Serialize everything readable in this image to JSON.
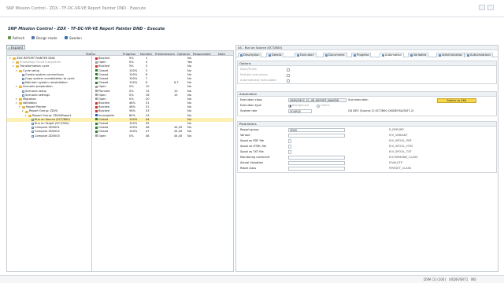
{
  "window": {
    "app_title": "SNP Mission Control - ZDX - TF-DC-VR-VE Report Painter DND - Execute"
  },
  "page": {
    "title": "SNP Mission Control - ZDX - TF-DC-VR-VE Report Painter DND - Execute"
  },
  "toolbar": {
    "refresh": "Refresh",
    "design_mode": "Design mode",
    "Sweden": "Sweden"
  },
  "left": {
    "expand": "Expand"
  },
  "tree": {
    "headers": {
      "name": "",
      "status": "Status",
      "progress": "Progress",
      "number": "Number",
      "predecessors": "Predecessors",
      "optional": "Optional",
      "responsible": "Responsible",
      "note": "Note"
    },
    "rows": [
      {
        "level": 0,
        "kind": "folder",
        "name": "ZDX REPORT PAINTER DND",
        "status": "Blocked",
        "color": "#d32f2f",
        "progress": "5%",
        "number": "1",
        "pred": "",
        "opt": "No",
        "sel": false
      },
      {
        "level": 1,
        "kind": "folder",
        "name": "Knowledge Cloud integration",
        "status": "Open",
        "color": "#9e9e9e",
        "progress": "0%",
        "number": "3",
        "pred": "",
        "opt": "Yes",
        "sel": false
      },
      {
        "level": 1,
        "kind": "folder",
        "name": "Transformation cycle",
        "status": "Blocked",
        "color": "#d32f2f",
        "progress": "5%",
        "number": "3",
        "pred": "",
        "opt": "No",
        "sel": false
      },
      {
        "level": 2,
        "kind": "folder",
        "name": "Cycle setup",
        "status": "Closed",
        "color": "#2e7d32",
        "progress": "100%",
        "number": "5",
        "pred": "",
        "opt": "No",
        "sel": false
      },
      {
        "level": 3,
        "kind": "task",
        "name": "Create system connections",
        "status": "Closed",
        "color": "#2e7d32",
        "progress": "100%",
        "number": "6",
        "pred": "",
        "opt": "No",
        "sel": false
      },
      {
        "level": 3,
        "kind": "task",
        "name": "Copy system constellation to cycle",
        "status": "Closed",
        "color": "#2e7d32",
        "progress": "100%",
        "number": "7",
        "pred": "",
        "opt": "No",
        "sel": false
      },
      {
        "level": 3,
        "kind": "task",
        "name": "Maintain system constellation",
        "status": "Closed",
        "color": "#2e7d32",
        "progress": "100%",
        "number": "8",
        "pred": "6,7",
        "opt": "No",
        "sel": false
      },
      {
        "level": 2,
        "kind": "folder",
        "name": "Scenario preparation",
        "status": "Open",
        "color": "#9e9e9e",
        "progress": "0%",
        "number": "10",
        "pred": "",
        "opt": "No",
        "sel": false
      },
      {
        "level": 3,
        "kind": "task",
        "name": "Scenario setup",
        "status": "Planned",
        "color": "#90a4ae",
        "progress": "0%",
        "number": "15",
        "pred": "10",
        "opt": "No",
        "sel": false
      },
      {
        "level": 3,
        "kind": "task",
        "name": "Scenario settings",
        "status": "Open",
        "color": "#9e9e9e",
        "progress": "0%",
        "number": "16",
        "pred": "15",
        "opt": "No",
        "sel": false
      },
      {
        "level": 2,
        "kind": "folder",
        "name": "Migration",
        "status": "Open",
        "color": "#9e9e9e",
        "progress": "0%",
        "number": "20",
        "pred": "",
        "opt": "No",
        "sel": false
      },
      {
        "level": 2,
        "kind": "folder",
        "name": "Validation",
        "status": "Blocked",
        "color": "#d32f2f",
        "progress": "48%",
        "number": "31",
        "pred": "",
        "opt": "No",
        "sel": false
      },
      {
        "level": 3,
        "kind": "folder",
        "name": "Report Painter",
        "status": "Blocked",
        "color": "#d32f2f",
        "progress": "48%",
        "number": "31",
        "pred": "",
        "opt": "No",
        "sel": false
      },
      {
        "level": 4,
        "kind": "folder",
        "name": "Report Group: ZDVII",
        "status": "Blocked",
        "color": "#d32f2f",
        "progress": "56%",
        "number": "33",
        "pred": "",
        "opt": "No",
        "sel": false
      },
      {
        "level": 5,
        "kind": "folder",
        "name": "Report Group: ZDVII/Report",
        "status": "Incomplete",
        "color": "#1565c0",
        "progress": "80%",
        "number": "43",
        "pred": "",
        "opt": "No",
        "sel": false
      },
      {
        "level": 6,
        "kind": "task",
        "name": "Run on Source (ECT/800)",
        "status": "Closed",
        "color": "#2e7d32",
        "progress": "100%",
        "number": "44",
        "pred": "",
        "opt": "No",
        "sel": true
      },
      {
        "level": 6,
        "kind": "task",
        "name": "Run on Target (ECT/900)",
        "status": "Closed",
        "color": "#2e7d32",
        "progress": "100%",
        "number": "45",
        "pred": "",
        "opt": "No",
        "sel": false
      },
      {
        "level": 6,
        "kind": "task",
        "name": "Compare ZDVII01",
        "status": "Closed",
        "color": "#2e7d32",
        "progress": "100%",
        "number": "46",
        "pred": "44,45",
        "opt": "No",
        "sel": false
      },
      {
        "level": 6,
        "kind": "task",
        "name": "Compare ZDVII02",
        "status": "Closed",
        "color": "#2e7d32",
        "progress": "100%",
        "number": "47",
        "pred": "44,45",
        "opt": "No",
        "sel": false
      },
      {
        "level": 6,
        "kind": "task",
        "name": "Compare ZDVII03",
        "status": "Open",
        "color": "#9e9e9e",
        "progress": "0%",
        "number": "48",
        "pred": "44,45",
        "opt": "No",
        "sel": false
      }
    ]
  },
  "detail": {
    "title": "44 - Run on Source (ECT/800)",
    "tabs": [
      "Description",
      "Details",
      "Execution",
      "Documents",
      "Progress",
      "Automation",
      "Variables",
      "Administration",
      "Authorizations"
    ],
    "active_tab": "Automation",
    "options": {
      "title": "Options",
      "opt1": "Done/Finish",
      "opt2": "Multiple executions",
      "opt3": "Automatically executable"
    },
    "automation": {
      "title": "Automation",
      "class_label": "Execution class",
      "class_value": "/SNP/CMCC_CL_VR_REPORT_PAINTER",
      "sub_label": "Sub execution",
      "switch_label": "Switch to XML",
      "type_label": "Execution type",
      "type_bg": "Background",
      "type_online": "Online",
      "role_label": "System role",
      "role_value": "SOURCE",
      "role_desc": "Q4 DEV (Source 2) ECT/800 (XXDEVSA/SI07-2)"
    },
    "parameters": {
      "title": "Parameters",
      "rows": [
        {
          "label": "Report group",
          "value": "ZDVII",
          "code": "R_REPGRP"
        },
        {
          "label": "Variant",
          "value": "",
          "code": "R/V_VARIANT"
        },
        {
          "label": "Spool as PDF file",
          "value": "",
          "code": "R/V_SPOOL_PDF"
        },
        {
          "label": "Spool as HTML file",
          "value": "",
          "code": "R/V_SPOOL_HTM"
        },
        {
          "label": "Spool as TXT file",
          "value": "",
          "code": "R/V_SPOOL_TXT"
        },
        {
          "label": "Monitoring comment",
          "value": "",
          "code": "R/COMMAND_CLASS"
        },
        {
          "label": "Actual Valuation",
          "value": "",
          "code": "P/VALUTP"
        },
        {
          "label": "Reset class",
          "value": "",
          "code": "P/RESET_CLASS"
        }
      ]
    }
  },
  "status": {
    "system": "DSM (1) (100)",
    "server": "XXDEVSR71",
    "mode": "INS"
  }
}
